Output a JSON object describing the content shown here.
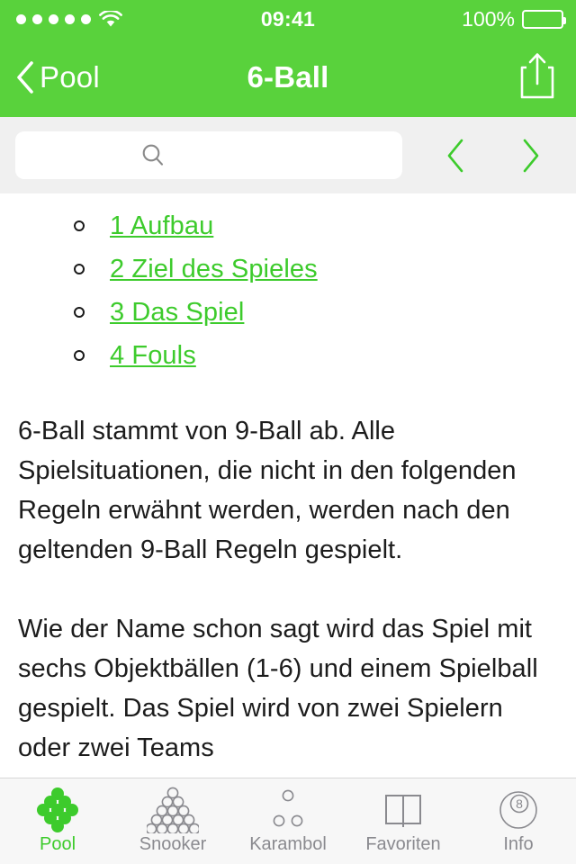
{
  "status_bar": {
    "signal_dots": 5,
    "wifi_icon": "wifi-icon",
    "time": "09:41",
    "battery_percent": "100%",
    "battery_icon": "battery-full-icon"
  },
  "nav_bar": {
    "back_icon": "chevron-left-icon",
    "back_label": "Pool",
    "title": "6-Ball",
    "share_icon": "share-icon"
  },
  "find_bar": {
    "search_icon": "search-icon",
    "search_value": "",
    "search_placeholder": "",
    "prev_icon": "chevron-left-icon",
    "next_icon": "chevron-right-icon"
  },
  "content": {
    "toc": [
      {
        "label": "1 Aufbau"
      },
      {
        "label": "2 Ziel des Spieles"
      },
      {
        "label": "3 Das Spiel"
      },
      {
        "label": "4 Fouls"
      }
    ],
    "paragraphs": [
      "6-Ball stammt von 9-Ball ab. Alle Spielsituationen, die nicht in den folgenden Regeln erwähnt werden, werden nach den geltenden 9-Ball Regeln gespielt.",
      "Wie der Name schon sagt wird das Spiel mit sechs Objektbällen (1-6) und einem Spielball gespielt. Das Spiel wird von zwei Spielern oder zwei Teams"
    ]
  },
  "tab_bar": {
    "tabs": [
      {
        "label": "Pool",
        "icon": "pool-rack-diamond-icon",
        "active": true
      },
      {
        "label": "Snooker",
        "icon": "snooker-rack-triangle-icon",
        "active": false
      },
      {
        "label": "Karambol",
        "icon": "carom-three-balls-icon",
        "active": false
      },
      {
        "label": "Favoriten",
        "icon": "open-book-icon",
        "active": false
      },
      {
        "label": "Info",
        "icon": "eight-ball-icon",
        "active": false
      }
    ]
  },
  "colors": {
    "brand_green": "#59D23C",
    "link_green": "#3DCB2C",
    "bar_gray": "#F0F0F0",
    "tabbar_gray": "#F7F7F7",
    "inactive_tab": "#8A8A8F"
  }
}
